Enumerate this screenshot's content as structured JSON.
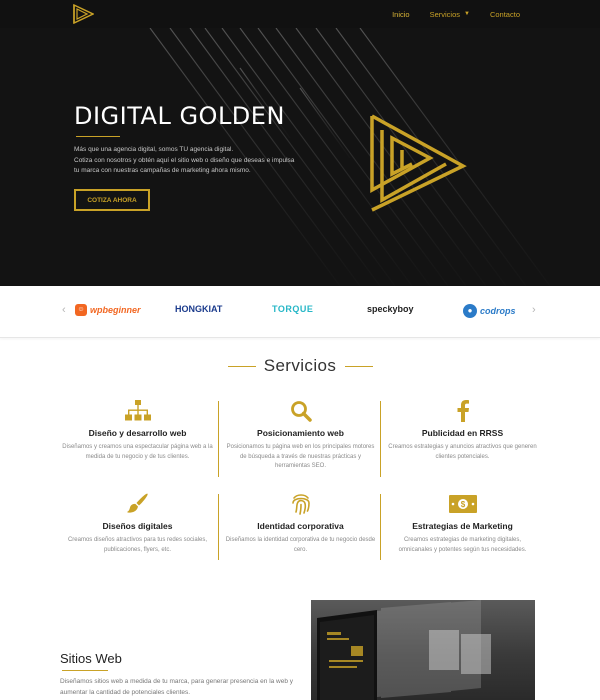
{
  "nav": {
    "items": [
      {
        "label": "Inicio",
        "active": true
      },
      {
        "label": "Servicios",
        "has_dropdown": true
      },
      {
        "label": "Contacto"
      }
    ]
  },
  "hero": {
    "title": "DIGITAL GOLDEN",
    "lead_lines": [
      "Más que una agencia digital, somos TU agencia digital.",
      "Cotiza con nosotros y obtén aquí el sitio web o diseño que deseas e impulsa",
      "tu marca con nuestras campañas de marketing ahora mismo."
    ],
    "cta": "COTIZA AHORA"
  },
  "clients": {
    "brands": [
      "wpbeginner",
      "HONGKIAT",
      "TORQUE",
      "speckyboy",
      "codrops"
    ]
  },
  "services": {
    "title": "Servicios",
    "items": [
      {
        "icon": "sitemap-icon",
        "title": "Diseño y desarrollo web",
        "text": "Diseñamos y creamos una espectacular página web a la medida de tu negocio y de tus clientes."
      },
      {
        "icon": "search-icon",
        "title": "Posicionamiento web",
        "text": "Posicionamos tu página web en los principales motores de búsqueda a través de nuestras prácticas y herramientas SEO."
      },
      {
        "icon": "facebook-icon",
        "title": "Publicidad en RRSS",
        "text": "Creamos estrategias y anuncios atractivos que generen clientes potenciales."
      },
      {
        "icon": "paintbrush-icon",
        "title": "Diseños digitales",
        "text": "Creamos diseños atractivos para tus redes sociales, publicaciones, flyers, etc."
      },
      {
        "icon": "fingerprint-icon",
        "title": "Identidad corporativa",
        "text": "Diseñamos la identidad corporativa de tu negocio desde cero."
      },
      {
        "icon": "money-bill-icon",
        "title": "Estrategias de Marketing",
        "text": "Creamos estrategias de marketing digitales, omnicanales y potentes según tus necesidades."
      }
    ]
  },
  "sitios": {
    "title": "Sitios Web",
    "text": "Diseñamos sitios web a medida de tu marca, para generar presencia en la web y aumentar la cantidad de potenciales clientes."
  },
  "colors": {
    "gold": "#c9a227",
    "dark": "#131313"
  }
}
